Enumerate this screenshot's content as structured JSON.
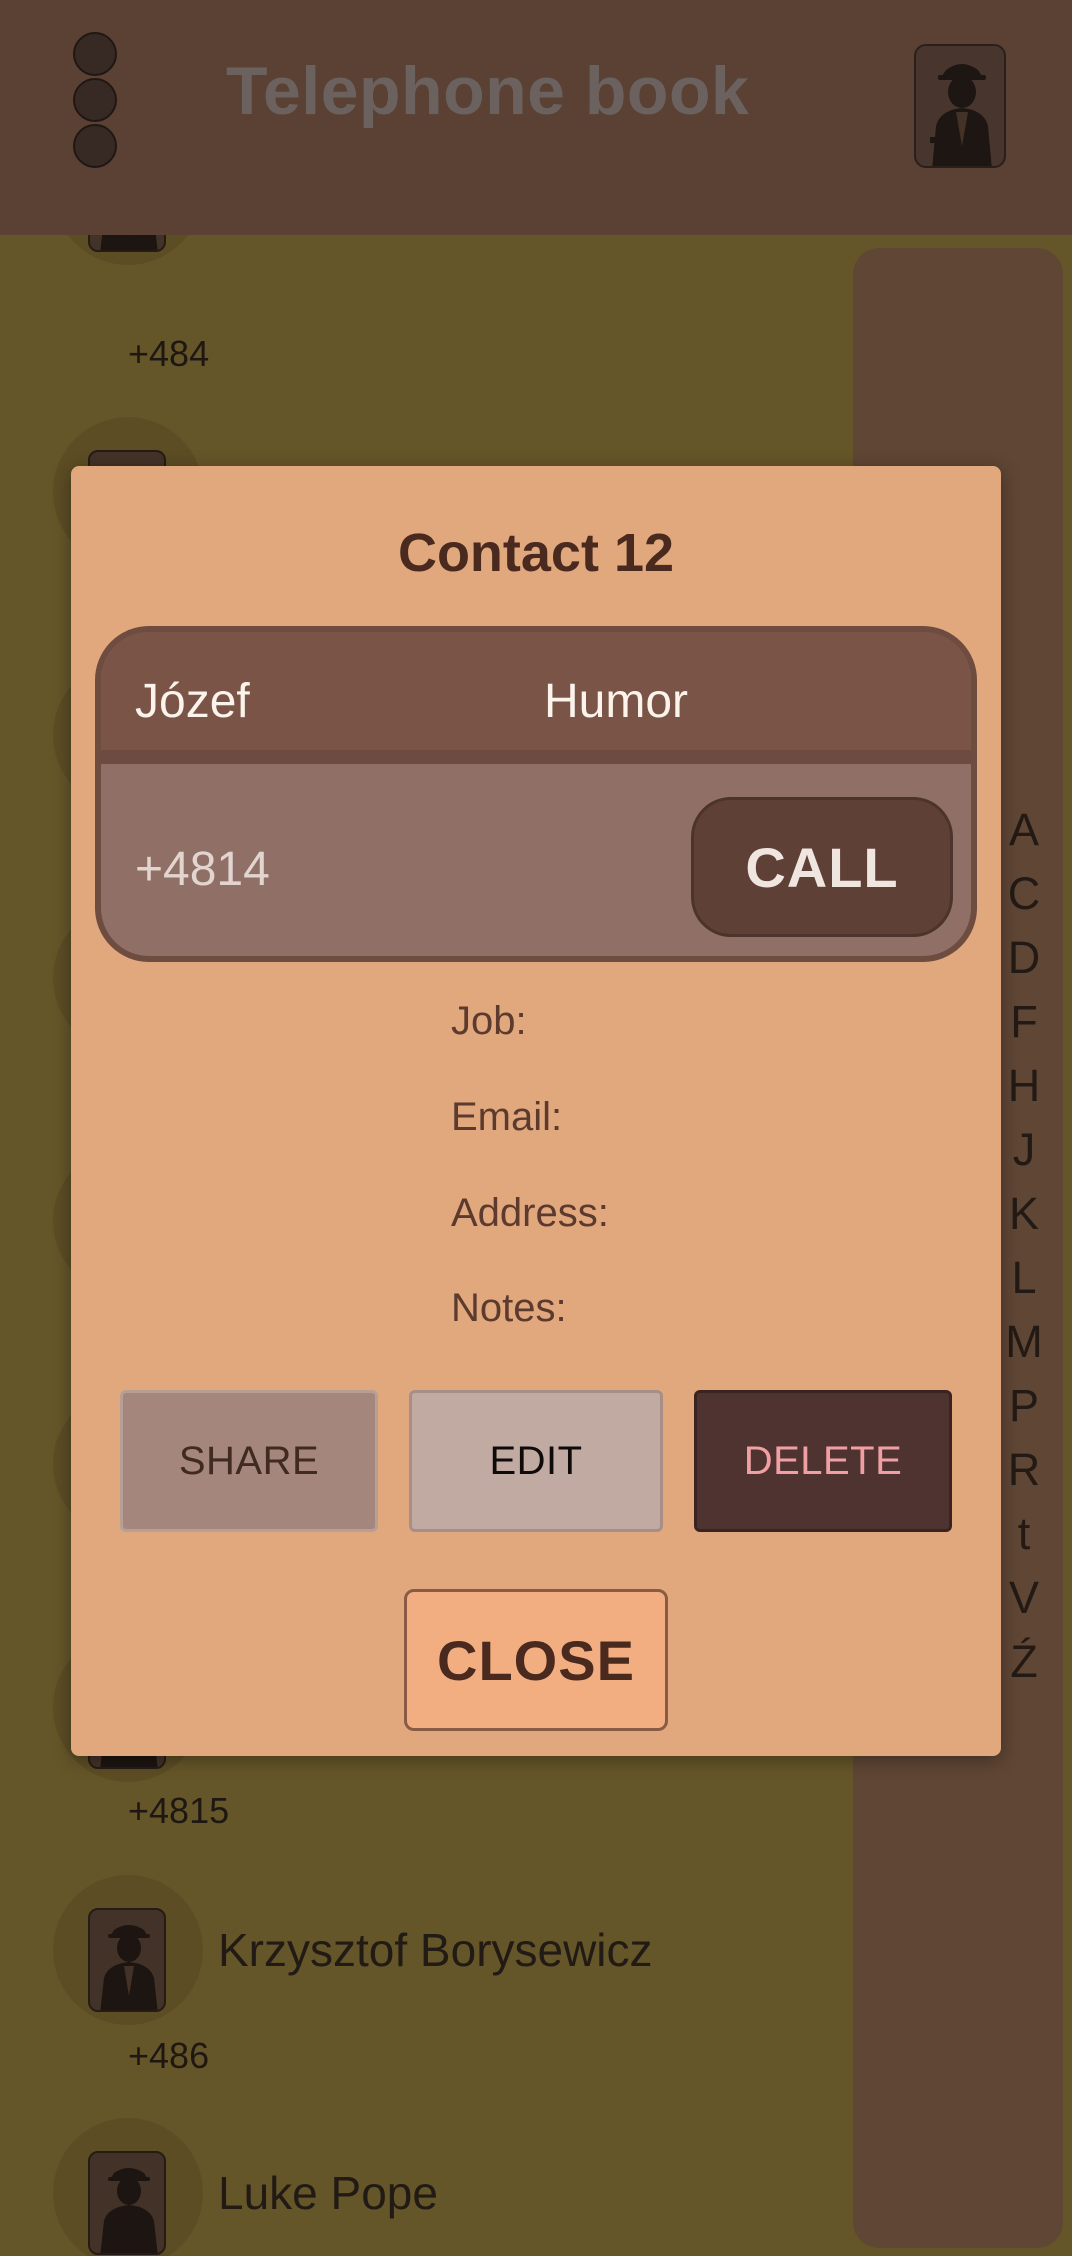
{
  "app_bar": {
    "title": "Telephone book",
    "menu_icon": "more-vertical-icon",
    "add_contact_icon": "add-contact-icon"
  },
  "contact_list": {
    "items": [
      {
        "name": "",
        "phone": "+484"
      },
      {
        "name": "",
        "phone": ""
      },
      {
        "name": "",
        "phone": ""
      },
      {
        "name": "",
        "phone": ""
      },
      {
        "name": "",
        "phone": ""
      },
      {
        "name": "",
        "phone": ""
      },
      {
        "name": "",
        "phone": "+4815"
      },
      {
        "name": "Krzysztof Borysewicz",
        "phone": "+486"
      },
      {
        "name": "Luke Pope",
        "phone": ""
      }
    ]
  },
  "alphabet_index": [
    "A",
    "C",
    "D",
    "F",
    "H",
    "J",
    "K",
    "L",
    "M",
    "P",
    "R",
    "t",
    "V",
    "Ź"
  ],
  "dialog": {
    "title": "Contact 12",
    "first_name": "Józef",
    "last_name": "Humor",
    "phone": "+4814",
    "call_label": "CALL",
    "fields": {
      "job": "Job:",
      "email": "Email:",
      "address": "Address:",
      "notes": "Notes:"
    },
    "share_label": "SHARE",
    "edit_label": "EDIT",
    "delete_label": "DELETE",
    "close_label": "CLOSE"
  },
  "colors": {
    "app_bar": "#5a4133",
    "list_background": "#655629",
    "dialog_background": "#e1a87e",
    "accent_brown": "#5e4036",
    "delete_text": "#f0a0a4"
  }
}
